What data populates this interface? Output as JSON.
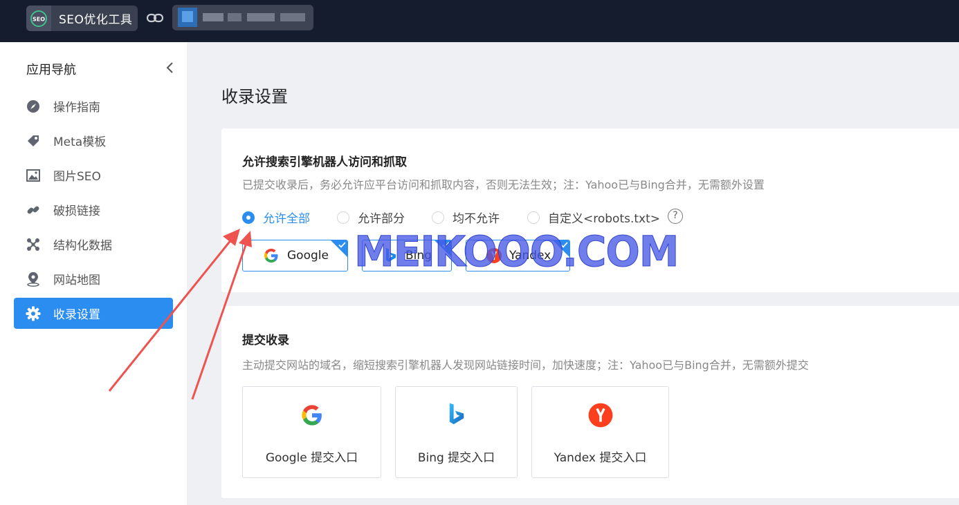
{
  "topbar": {
    "app_name": "SEO优化工具",
    "app_logo_icon": "seo-logo-icon",
    "link_icon": "link-icon"
  },
  "sidebar": {
    "title": "应用导航",
    "items": [
      {
        "label": "操作指南",
        "icon": "compass-icon"
      },
      {
        "label": "Meta模板",
        "icon": "tag-icon"
      },
      {
        "label": "图片SEO",
        "icon": "image-icon"
      },
      {
        "label": "破损链接",
        "icon": "broken-link-icon"
      },
      {
        "label": "结构化数据",
        "icon": "network-icon"
      },
      {
        "label": "网站地图",
        "icon": "map-pin-icon"
      },
      {
        "label": "收录设置",
        "icon": "gear-icon",
        "active": true
      }
    ]
  },
  "main": {
    "title": "收录设置",
    "crawl": {
      "heading": "允许搜索引擎机器人访问和抓取",
      "desc": "已提交收录后，务必允许应平台访问和抓取内容，否则无法生效；注：Yahoo已与Bing合并，无需额外设置",
      "options": [
        "允许全部",
        "允许部分",
        "均不允许",
        "自定义<robots.txt>"
      ],
      "selected": "允许全部",
      "help": "?",
      "engines": [
        {
          "label": "Google",
          "checked": true
        },
        {
          "label": "Bing",
          "checked": true
        },
        {
          "label": "Yandex",
          "checked": true
        }
      ]
    },
    "submit": {
      "heading": "提交收录",
      "desc": "主动提交网站的域名，缩短搜索引擎机器人发现网站链接时间，加快速度；注：Yahoo已与Bing合并，无需额外提交",
      "entries": [
        "Google 提交入口",
        "Bing 提交入口",
        "Yandex 提交入口"
      ]
    }
  },
  "watermark": "MEIKOOO.COM",
  "colors": {
    "accent": "#2b8def",
    "topbar": "#151c2e",
    "arrow": "#ef5350"
  }
}
